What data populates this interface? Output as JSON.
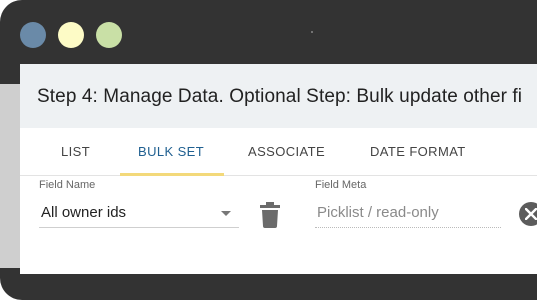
{
  "window": {
    "controls": [
      "close",
      "minimize",
      "maximize"
    ]
  },
  "header": {
    "title": "Step 4: Manage Data. Optional Step: Bulk update other fi"
  },
  "tabs": [
    {
      "label": "LIST",
      "active": false
    },
    {
      "label": "BULK SET",
      "active": true
    },
    {
      "label": "ASSOCIATE",
      "active": false
    },
    {
      "label": "DATE FORMAT",
      "active": false
    }
  ],
  "form": {
    "field_name_label": "Field Name",
    "field_name_value": "All owner ids",
    "field_meta_label": "Field Meta",
    "field_meta_value": "Picklist / read-only"
  },
  "icons": {
    "field_select": "chevron-down-icon",
    "delete": "trash-icon",
    "clear": "close-icon"
  },
  "colors": {
    "accent_tab": "#1f5f90",
    "tab_underline": "#f3d97a",
    "header_band": "#eef1f3",
    "window_chrome": "#333333"
  }
}
